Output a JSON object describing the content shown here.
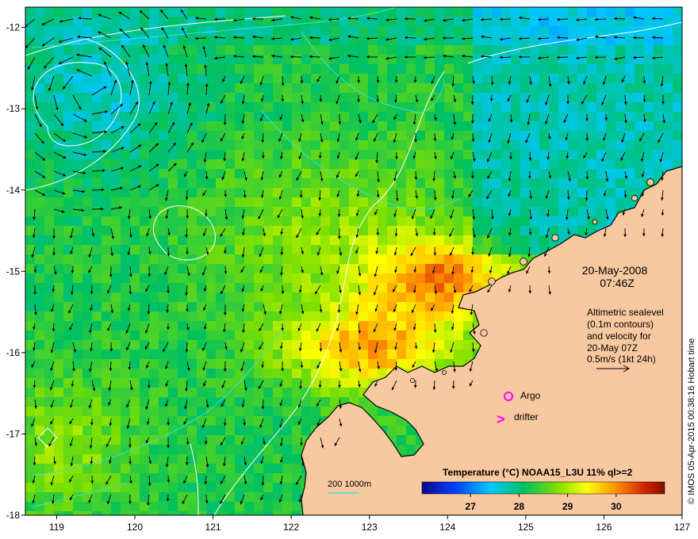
{
  "map": {
    "date": "20-May-2008",
    "time": "07:46Z",
    "legend": {
      "line1": "Altimetric sealevel",
      "line2": "(0.1m contours)",
      "line3": "and velocity for",
      "line4": "20-May 07Z",
      "line5": "0.5m/s (1kt 24h)"
    },
    "argo_label": "Argo",
    "drifter_label": "drifter",
    "drifter_glyph": ">",
    "depth_label": "200  1000m",
    "colorbar": {
      "title": "Temperature (°C) NOAA15_L3U 11% ql>=2",
      "ticks": [
        "27",
        "28",
        "29",
        "30"
      ],
      "tick_values": [
        27,
        28,
        29,
        30
      ],
      "range": [
        26,
        31
      ]
    },
    "credit": "© IMOS 05-Apr-2015 00:38:16 Hobart time",
    "x_ticks": [
      "119",
      "120",
      "121",
      "122",
      "123",
      "124",
      "125",
      "126",
      "127"
    ],
    "x_values": [
      119,
      120,
      121,
      122,
      123,
      124,
      125,
      126,
      127
    ],
    "y_ticks": [
      "-12",
      "-13",
      "-14",
      "-15",
      "-16",
      "-17",
      "-18"
    ],
    "y_values": [
      -12,
      -13,
      -14,
      -15,
      -16,
      -17,
      -18
    ],
    "lon_range": [
      118.6,
      127
    ],
    "lat_range": [
      -11.75,
      -18
    ],
    "colors": {
      "land": "#f8c8a0",
      "coast": "#000000",
      "iso200": "#40e0d0",
      "contour": "#ffffff",
      "argo": "#ff00ff",
      "drifter": "#ff00ff"
    }
  }
}
